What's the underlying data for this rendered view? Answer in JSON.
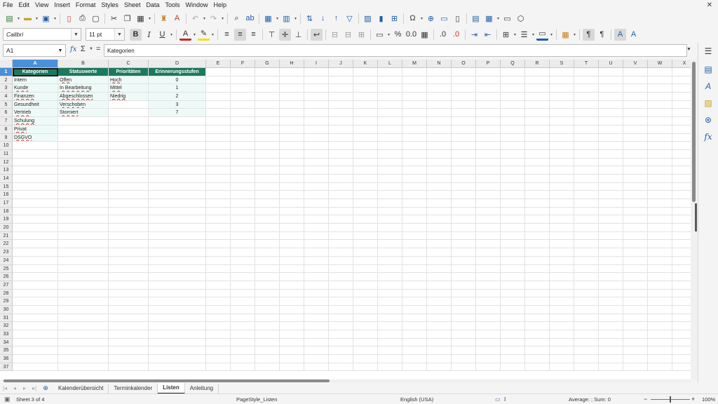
{
  "menu": [
    "File",
    "Edit",
    "View",
    "Insert",
    "Format",
    "Styles",
    "Sheet",
    "Data",
    "Tools",
    "Window",
    "Help"
  ],
  "toolbar": {
    "font_name": "Calibri",
    "font_size": "11 pt",
    "bold_label": "B",
    "italic_label": "I",
    "underline_label": "U"
  },
  "formula": {
    "cell_ref": "A1",
    "content": "Kategorien"
  },
  "columns": [
    "A",
    "B",
    "C",
    "D",
    "E",
    "F",
    "G",
    "H",
    "I",
    "J",
    "K",
    "L",
    "M",
    "N",
    "O",
    "P",
    "Q",
    "R",
    "S",
    "T",
    "U",
    "V",
    "W",
    "X"
  ],
  "rows": [
    "1",
    "2",
    "3",
    "4",
    "5",
    "6",
    "7",
    "8",
    "9",
    "10",
    "11",
    "12",
    "13",
    "14",
    "15",
    "16",
    "17",
    "18",
    "19",
    "20",
    "21",
    "22",
    "23",
    "24",
    "25",
    "26",
    "27",
    "28",
    "29",
    "30",
    "31",
    "32",
    "33",
    "34",
    "35",
    "36",
    "37"
  ],
  "sheet": {
    "headers": [
      "Kategorien",
      "Statuswerte",
      "Prioritäten",
      "Erinnerungsstufen"
    ],
    "kategorien": [
      "Intern",
      "Kunde",
      "Finanzen",
      "Gesundheit",
      "Vertrieb",
      "Schulung",
      "Privat",
      "DSGVO"
    ],
    "statuswerte": [
      "Offen",
      "In Bearbeitung",
      "Abgeschlossen",
      "Verschoben",
      "Storniert"
    ],
    "prioritaeten": [
      "Hoch",
      "Mittel",
      "Niedrig"
    ],
    "erinnerungsstufen": [
      "0",
      "1",
      "2",
      "3",
      "7"
    ]
  },
  "tabs": {
    "items": [
      "Kalenderübersicht",
      "Terminkalender",
      "Listen",
      "Anleitung"
    ],
    "active": "Listen"
  },
  "status": {
    "sheet_info": "Sheet 3 of 4",
    "page_style": "PageStyle_Listen",
    "language": "English (USA)",
    "summary": "Average: ; Sum: 0",
    "zoom": "100%"
  },
  "colors": {
    "header_fill": "#1b7a5e",
    "data_fill": "#eefaf7",
    "selection": "#4a90d9",
    "accent": "#1f5ea8"
  }
}
